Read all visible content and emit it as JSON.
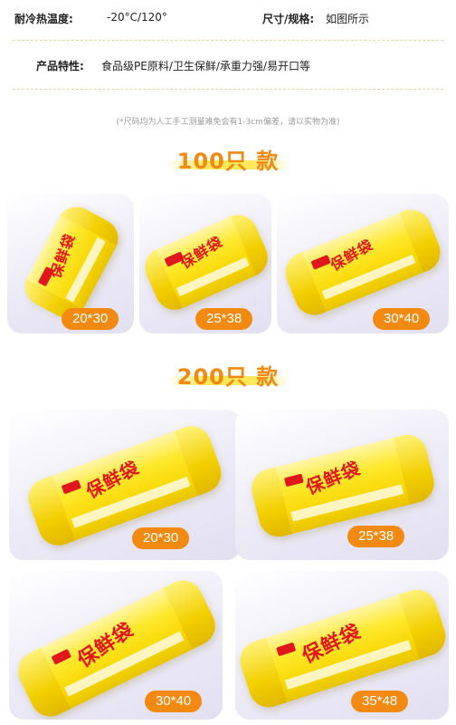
{
  "specs": {
    "temp_label": "耐冷热温度:",
    "temp_value": "-20°C/120°",
    "size_label": "尺寸/规格:",
    "size_value": "如图所示",
    "feature_label": "产品特性:",
    "feature_value": "食品级PE原料/卫生保鲜/承重力强/易开口等"
  },
  "note": "(*尺码均为人工手工测量难免会有1-3cm偏差，请以实物为准)",
  "product": {
    "brand_text": "保鲜袋"
  },
  "sections": [
    {
      "title": "100只 款",
      "items": [
        {
          "size": "20*30"
        },
        {
          "size": "25*38"
        },
        {
          "size": "30*40"
        }
      ]
    },
    {
      "title": "200只 款",
      "items": [
        {
          "size": "20*30"
        },
        {
          "size": "25*38"
        },
        {
          "size": "30*40"
        },
        {
          "size": "35*48"
        }
      ]
    }
  ],
  "colors": {
    "accent": "#f28a12",
    "highlight": "#ffe85a",
    "roll_yellow": "#ffe82e",
    "brand_red": "#e0181e"
  }
}
